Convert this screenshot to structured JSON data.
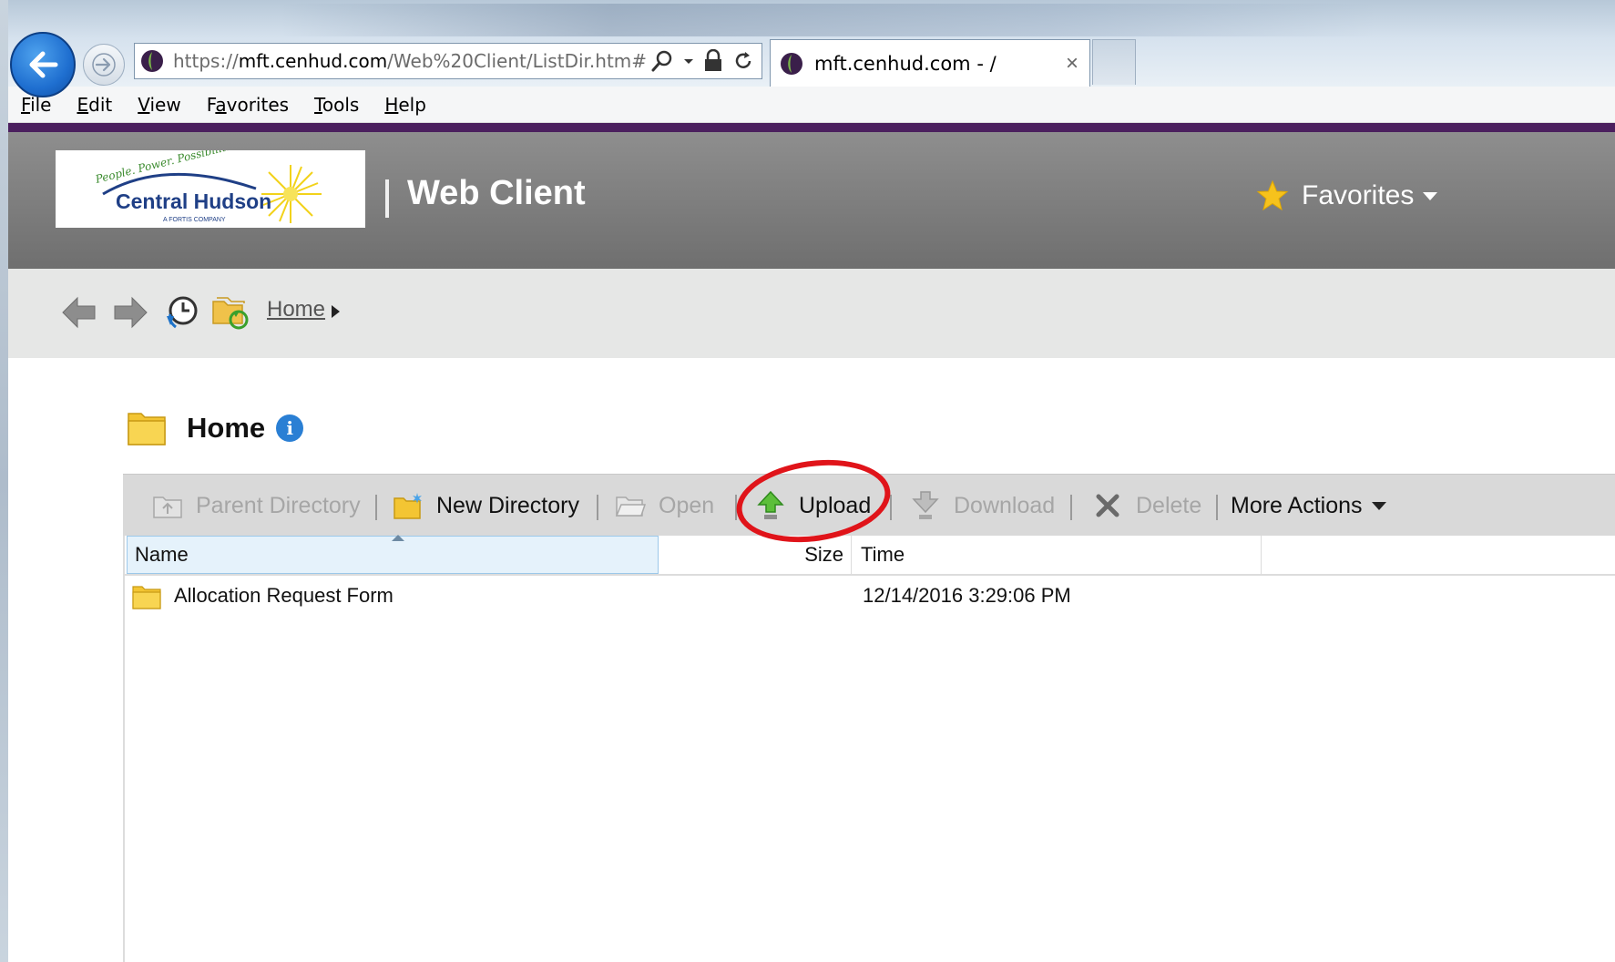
{
  "browser": {
    "url_prefix": "https://",
    "url_domain": "mft.cenhud.com",
    "url_path": "/Web%20Client/ListDir.htm#",
    "tab_title": "mft.cenhud.com - /",
    "tab_close": "×",
    "icons": [
      "back-arrow-icon",
      "forward-arrow-icon",
      "site-icon",
      "search-icon",
      "lock-icon",
      "refresh-icon",
      "close-icon"
    ]
  },
  "menu": {
    "items": [
      {
        "u": "F",
        "rest": "ile"
      },
      {
        "u": "E",
        "rest": "dit"
      },
      {
        "u": "V",
        "rest": "iew"
      },
      {
        "pre": "F",
        "u": "a",
        "rest": "vorites"
      },
      {
        "u": "T",
        "rest": "ools"
      },
      {
        "u": "H",
        "rest": "elp"
      }
    ]
  },
  "header": {
    "logo": {
      "tagline": "People. Power. Possibilities.",
      "name": "Central Hudson",
      "sub": "A FORTIS COMPANY"
    },
    "app_title": "Web Client",
    "favorites_label": "Favorites"
  },
  "nav": {
    "breadcrumb_home": "Home"
  },
  "folder": {
    "title": "Home",
    "info": "i"
  },
  "toolbar": {
    "parent_directory": "Parent Directory",
    "new_directory": "New Directory",
    "open": "Open",
    "upload": "Upload",
    "download": "Download",
    "delete": "Delete",
    "more_actions": "More Actions"
  },
  "table": {
    "columns": {
      "name": "Name",
      "size": "Size",
      "time": "Time"
    },
    "rows": [
      {
        "name": "Allocation Request Form",
        "size": "",
        "time": "12/14/2016 3:29:06 PM"
      }
    ]
  },
  "colors": {
    "header_purple": "#4b1f5e",
    "header_gray": "#7a7a7a",
    "highlight_red": "#e0141a",
    "selected_column": "#e5f2fb"
  }
}
